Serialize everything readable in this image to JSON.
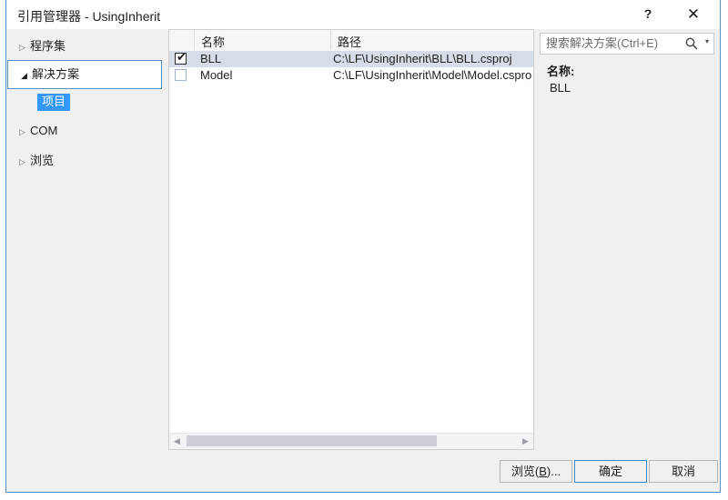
{
  "window": {
    "title": "引用管理器 - UsingInherit",
    "help_icon": "question-mark-icon",
    "help_label": "?",
    "close_icon": "close-icon",
    "close_label": "✕",
    "border_color": "#5a8fc4"
  },
  "sidebar": {
    "items": [
      {
        "label": "程序集",
        "state": "collapsed",
        "marker": "▷"
      },
      {
        "label": "解决方案",
        "state": "expanded",
        "marker": "◢"
      },
      {
        "label": "COM",
        "state": "collapsed",
        "marker": "▷"
      },
      {
        "label": "浏览",
        "state": "collapsed",
        "marker": "▷"
      }
    ],
    "child": {
      "label": "项目",
      "selected": true,
      "selected_color": "#3399ff"
    }
  },
  "list": {
    "columns": [
      {
        "key": "check",
        "label": ""
      },
      {
        "key": "name",
        "label": "名称"
      },
      {
        "key": "path",
        "label": "路径"
      }
    ],
    "rows": [
      {
        "checked": true,
        "check_glyph": "✔",
        "name": "BLL",
        "path": "C:\\LF\\UsingInherit\\BLL\\BLL.csproj",
        "selected": true
      },
      {
        "checked": false,
        "check_glyph": "",
        "name": "Model",
        "path": "C:\\LF\\UsingInherit\\Model\\Model.csproj",
        "selected": false
      }
    ],
    "scrollbar": {
      "left_arrow": "◀",
      "right_arrow": "▶",
      "thumb_position_percent": 0,
      "thumb_width_percent": 76
    }
  },
  "search": {
    "value": "",
    "placeholder": "搜索解决方案(Ctrl+E)",
    "icon": "search-icon",
    "caret": "▾"
  },
  "detail": {
    "label": "名称:",
    "value": "BLL"
  },
  "footer": {
    "browse": {
      "pre": "浏览(",
      "accel": "B",
      "post": ")..."
    },
    "ok_label": "确定",
    "cancel_label": "取消"
  }
}
